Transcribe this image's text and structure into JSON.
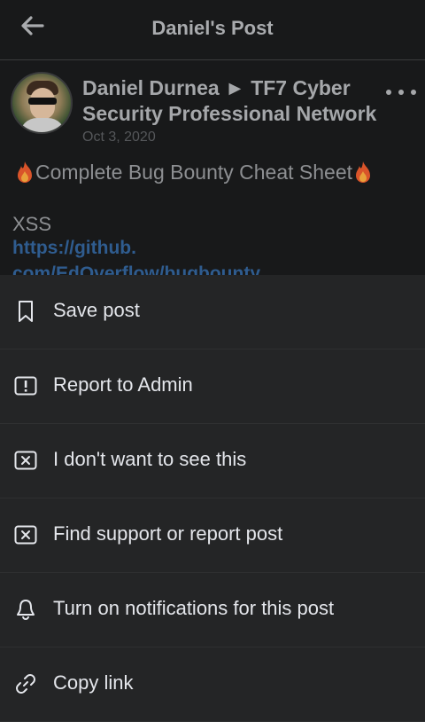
{
  "header": {
    "title": "Daniel's Post"
  },
  "post": {
    "author_line": "Daniel Durnea ► TF7 Cyber Security Professional Network",
    "date": "Oct 3, 2020",
    "title": "Complete Bug Bounty Cheat Sheet",
    "section": "XSS",
    "link_line1": "https://github.",
    "link_line2": "com/EdOverflow/bugbounty"
  },
  "menu": {
    "items": [
      {
        "label": "Save post",
        "icon": "bookmark-icon"
      },
      {
        "label": "Report to Admin",
        "icon": "alert-box-icon"
      },
      {
        "label": "I don't want to see this",
        "icon": "close-box-icon"
      },
      {
        "label": "Find support or report post",
        "icon": "close-box-icon"
      },
      {
        "label": "Turn on notifications for this post",
        "icon": "bell-icon"
      },
      {
        "label": "Copy link",
        "icon": "link-icon"
      }
    ]
  },
  "colors": {
    "background": "#18191a",
    "sheet": "#242526",
    "text_primary": "#e4e6eb",
    "link": "#2f5c8f"
  }
}
